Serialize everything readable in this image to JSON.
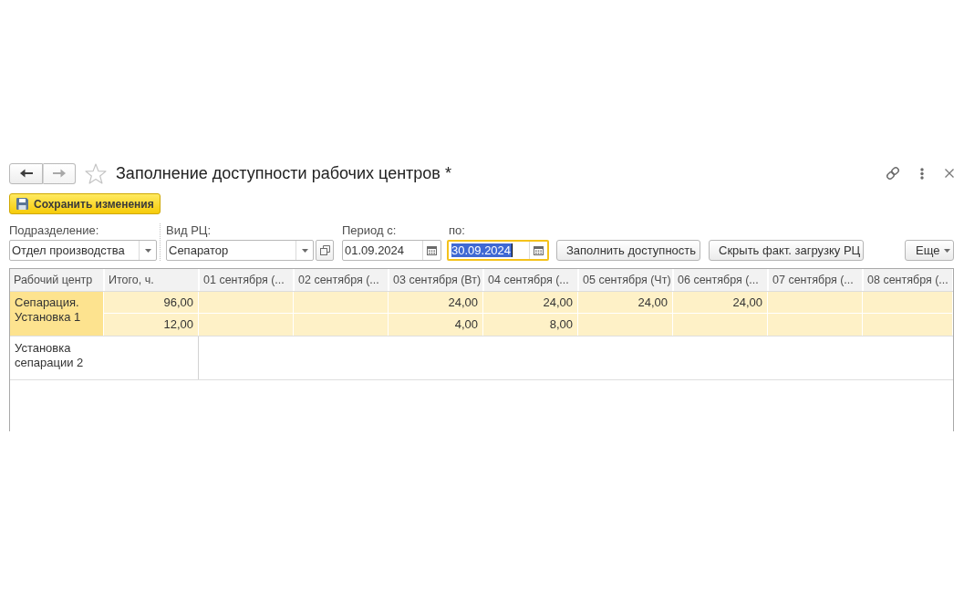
{
  "window": {
    "title": "Заполнение доступности рабочих центров *",
    "favorite": false
  },
  "navigation": [
    {
      "kind": "back",
      "disabled": false
    },
    {
      "kind": "forward",
      "disabled": true
    }
  ],
  "save_button": {
    "label": "Сохранить изменения"
  },
  "filters": [
    {
      "kind": "dropdown",
      "label": "Подразделение:",
      "value": "Отдел производства",
      "focused": false
    },
    {
      "kind": "dropdown_open",
      "label": "Вид РЦ:",
      "value": "Сепаратор",
      "focused": false
    },
    {
      "kind": "date",
      "label": "Период с:",
      "value": "01.09.2024",
      "focused": false
    },
    {
      "kind": "date",
      "label": "по:",
      "value": "30.09.2024",
      "focused": true
    }
  ],
  "actions": [
    {
      "label": "Заполнить доступность"
    },
    {
      "label": "Скрыть факт. загрузку РЦ"
    }
  ],
  "more_menu": {
    "label": "Еще"
  },
  "table": {
    "columns": [
      "Рабочий центр",
      "Итого, ч.",
      "01 сентября (...",
      "02 сентября (...",
      "03 сентября (Вт)",
      "04 сентября (...",
      "05 сентября (Чт)",
      "06 сентября (...",
      "07 сентября (...",
      "08 сентября (..."
    ],
    "rows": [
      {
        "name": "Сепарация. Установка 1",
        "selected": true,
        "lines": [
          {
            "total": "96,00",
            "days": [
              {
                "kind": "blank"
              },
              {
                "kind": "blank"
              },
              {
                "kind": "value",
                "text": "24,00"
              },
              {
                "kind": "value",
                "text": "24,00"
              },
              {
                "kind": "value",
                "text": "24,00"
              },
              {
                "kind": "value",
                "text": "24,00"
              },
              {
                "kind": "blank"
              },
              {
                "kind": "blank"
              }
            ]
          },
          {
            "total": "12,00",
            "days": [
              {
                "kind": "blank"
              },
              {
                "kind": "blank"
              },
              {
                "kind": "value",
                "text": "4,00"
              },
              {
                "kind": "value",
                "text": "8,00"
              },
              {
                "kind": "blank"
              },
              {
                "kind": "blank"
              },
              {
                "kind": "blank"
              },
              {
                "kind": "blank"
              }
            ]
          }
        ]
      },
      {
        "name": "Установка сепарации 2",
        "selected": false
      }
    ]
  }
}
